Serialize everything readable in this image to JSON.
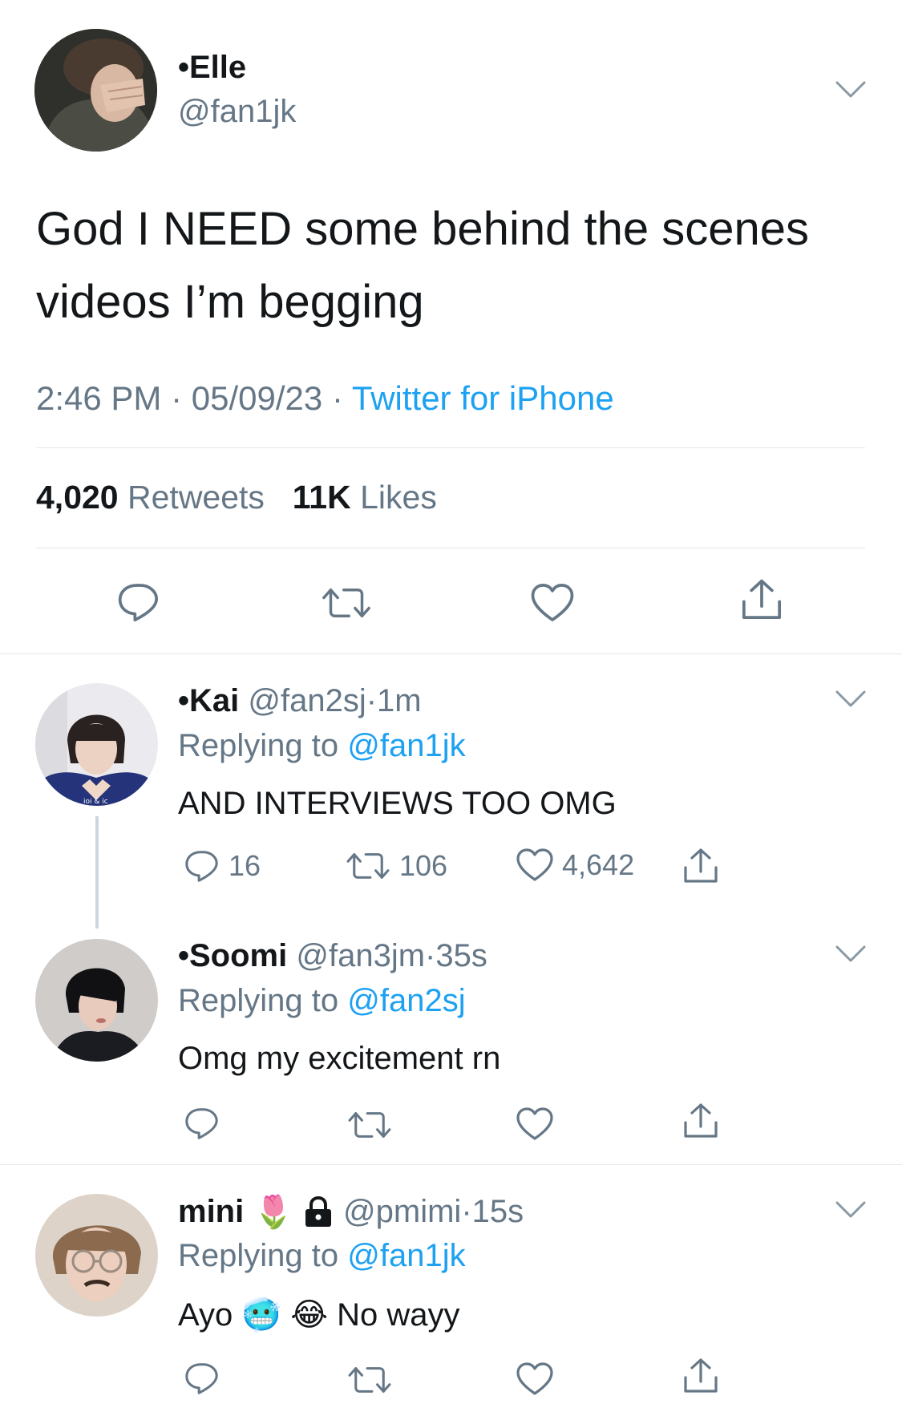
{
  "main_tweet": {
    "display_name": "•Elle",
    "handle": "@fan1jk",
    "text_line1": "God I NEED some behind the scenes",
    "text_line2": "videos I’m begging",
    "time": "2:46 PM",
    "date": "05/09/23",
    "source": "Twitter for iPhone",
    "retweet_count": "4,020",
    "retweet_label": "Retweets",
    "like_count": "11K",
    "like_label": "Likes"
  },
  "replies": [
    {
      "display_name": "•Kai",
      "handle": "@fan2sj",
      "time": "1m",
      "replying_prefix": "Replying to",
      "replying_to": "@fan1jk",
      "text": "AND INTERVIEWS TOO OMG",
      "reply_count": "16",
      "retweet_count": "106",
      "like_count": "4,642"
    },
    {
      "display_name": "•Soomi",
      "handle": "@fan3jm",
      "time": "35s",
      "replying_prefix": "Replying to",
      "replying_to": "@fan2sj",
      "text": "Omg my excitement rn"
    },
    {
      "display_name": "mini",
      "name_emoji": "🌷",
      "locked_icon": "lock-icon",
      "handle": "@pmimi",
      "time": "15s",
      "replying_prefix": "Replying to",
      "replying_to": "@fan1jk",
      "text_start": "Ayo",
      "text_emojis": "🥶 😂",
      "text_end": "No wayy"
    }
  ],
  "separator": "·",
  "colors": {
    "link": "#1da1f2",
    "secondary": "#657786",
    "divider": "#e1e8ed"
  },
  "icons": [
    "chevron-down-icon",
    "reply-icon",
    "retweet-icon",
    "like-icon",
    "share-icon"
  ]
}
